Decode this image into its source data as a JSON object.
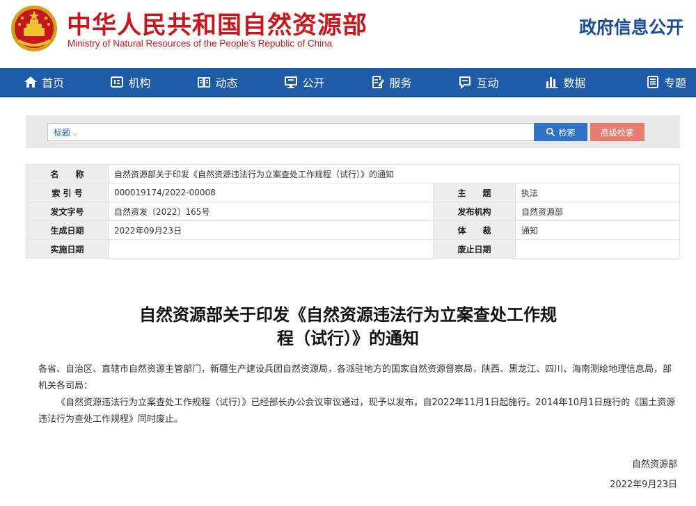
{
  "header": {
    "cn_title": "中华人民共和国自然资源部",
    "en_title": "Ministry of Natural Resources of the People’s Republic of China",
    "right_title": "政府信息公开",
    "brand_red": "#c8161d",
    "brand_blue": "#1a4b9b"
  },
  "nav": {
    "bg_color": "#1d5aa8",
    "items": [
      {
        "label": "首页",
        "icon": "home-icon"
      },
      {
        "label": "机构",
        "icon": "org-icon"
      },
      {
        "label": "动态",
        "icon": "news-book-icon"
      },
      {
        "label": "公开",
        "icon": "monitor-icon"
      },
      {
        "label": "服务",
        "icon": "edit-document-icon"
      },
      {
        "label": "互动",
        "icon": "chat-icon"
      },
      {
        "label": "数据",
        "icon": "bar-chart-icon"
      },
      {
        "label": "专题",
        "icon": "topic-book-icon"
      }
    ]
  },
  "search": {
    "select_label": "标题",
    "query": "",
    "search_button": "检索",
    "advanced_button": "高级检索"
  },
  "info": {
    "name_label": "名　　称",
    "name_value": "自然资源部关于印发《自然资源违法行为立案查处工作规程（试行）》的通知",
    "index_label": "索 引 号",
    "index_value": "000019174/2022-00008",
    "subject_label": "主　　题",
    "subject_value": "执法",
    "doc_no_label": "发文字号",
    "doc_no_value": "自然资发〔2022〕165号",
    "issuer_label": "发布机构",
    "issuer_value": "自然资源部",
    "created_label": "生成日期",
    "created_value": "2022年09月23日",
    "genre_label": "体　　裁",
    "genre_value": "通知",
    "effective_label": "实施日期",
    "effective_value": "",
    "repeal_label": "废止日期",
    "repeal_value": ""
  },
  "document": {
    "title_line1": "自然资源部关于印发《自然资源违法行为立案查处工作规",
    "title_line2": "程（试行）》的通知",
    "recipients": "各省、自治区、直辖市自然资源主管部门，新疆生产建设兵团自然资源局，各派驻地方的国家自然资源督察局，陕西、黑龙江、四川、海南测绘地理信息局，部机关各司局：",
    "body": "《自然资源违法行为立案查处工作规程（试行）》已经部长办公会议审议通过，现予以发布，自2022年11月1日起施行。2014年10月1日施行的《国土资源违法行为查处工作规程》同时废止。",
    "signature_org": "自然资源部",
    "signature_date": "2022年9月23日"
  }
}
